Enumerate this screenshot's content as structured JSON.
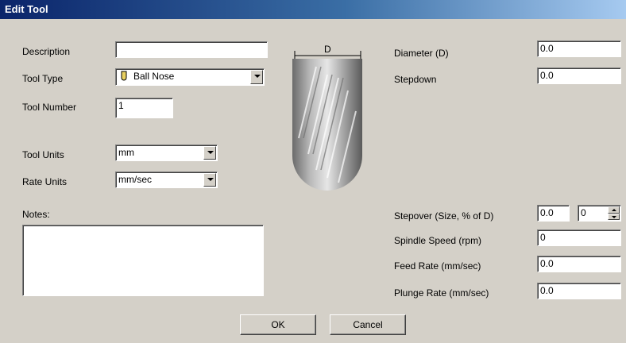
{
  "window": {
    "title": "Edit Tool"
  },
  "labels": {
    "description": "Description",
    "tool_type": "Tool Type",
    "tool_number": "Tool Number",
    "tool_units": "Tool Units",
    "rate_units": "Rate Units",
    "notes": "Notes:",
    "diameter": "Diameter (D)",
    "stepdown": "Stepdown",
    "stepover": "Stepover (Size, % of D)",
    "spindle_speed": "Spindle Speed (rpm)",
    "feed_rate": "Feed Rate (mm/sec)",
    "plunge_rate": "Plunge Rate (mm/sec)"
  },
  "fields": {
    "description": "",
    "tool_type": "Ball Nose",
    "tool_type_icon": "ball-nose-tool-icon",
    "tool_number": "1",
    "tool_units": "mm",
    "rate_units": "mm/sec",
    "notes": "",
    "diameter": "0.0",
    "stepdown": "0.0",
    "stepover_size": "0.0",
    "stepover_percent": "0",
    "spindle_speed": "0",
    "feed_rate": "0.0",
    "plunge_rate": "0.0"
  },
  "diagram": {
    "dimension_label": "D"
  },
  "buttons": {
    "ok": "OK",
    "cancel": "Cancel"
  }
}
